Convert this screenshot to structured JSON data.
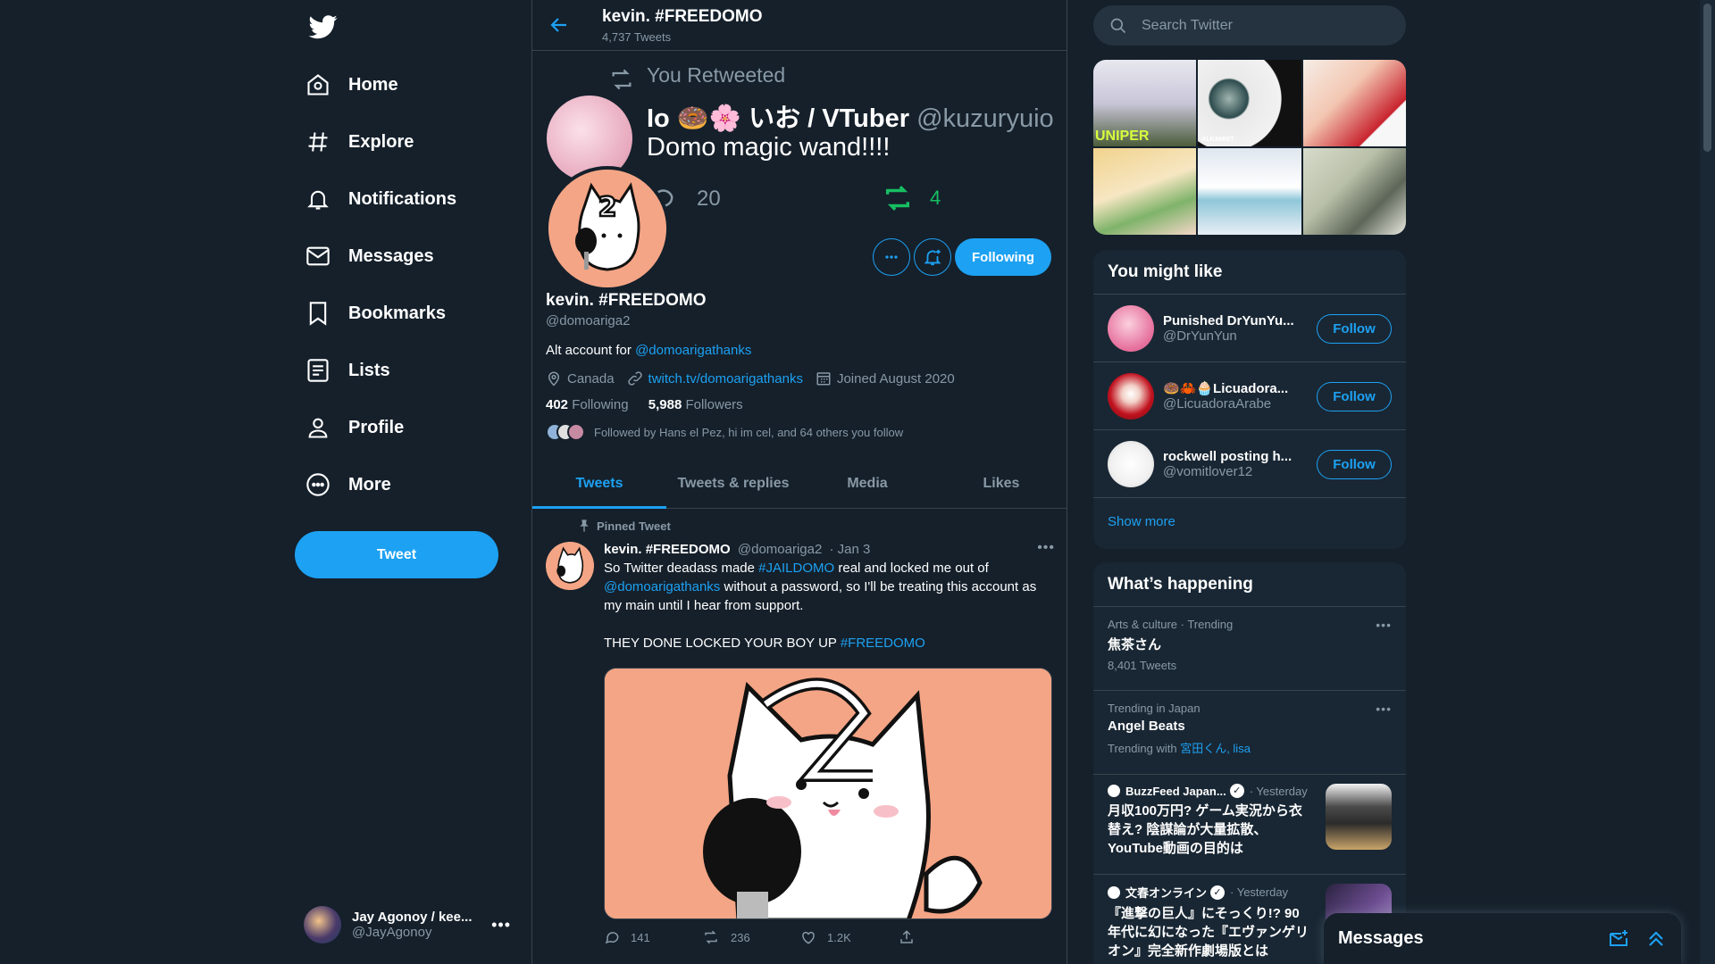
{
  "nav": {
    "items": [
      {
        "label": "Home",
        "icon": "home-icon"
      },
      {
        "label": "Explore",
        "icon": "hashtag-icon"
      },
      {
        "label": "Notifications",
        "icon": "bell-icon"
      },
      {
        "label": "Messages",
        "icon": "envelope-icon"
      },
      {
        "label": "Bookmarks",
        "icon": "bookmark-icon"
      },
      {
        "label": "Lists",
        "icon": "list-icon"
      },
      {
        "label": "Profile",
        "icon": "person-icon"
      },
      {
        "label": "More",
        "icon": "more-circle-icon"
      }
    ],
    "tweet_button": "Tweet",
    "account": {
      "name": "Jay Agonoy / kee...",
      "handle": "@JayAgonoy"
    }
  },
  "header": {
    "title": "kevin. #FREEDOMO",
    "tweet_count": "4,737 Tweets"
  },
  "banner": {
    "retweet_label": "You Retweeted",
    "name": "Io 🍩🌸 いお / VTuber",
    "handle": "@kuzuryuio",
    "text": "Domo magic wand!!!!",
    "reply_count": "20",
    "retweet_count": "4"
  },
  "profile": {
    "name": "kevin. #FREEDOMO",
    "handle": "@domoariga2",
    "bio_prefix": "Alt account for",
    "bio_link": "@domoarigathanks",
    "location": "Canada",
    "website": "twitch.tv/domoarigathanks",
    "joined": "Joined August 2020",
    "following_count": "402",
    "following_label": "Following",
    "followers_count": "5,988",
    "followers_label": "Followers",
    "followed_by": "Followed by Hans el Pez, hi im cel, and 64 others you follow",
    "following_button": "Following"
  },
  "tabs": [
    "Tweets",
    "Tweets & replies",
    "Media",
    "Likes"
  ],
  "active_tab": "Tweets",
  "pinned_tweet": {
    "pinned_label": "Pinned Tweet",
    "name": "kevin. #FREEDOMO",
    "handle": "@domoariga2",
    "date": "· Jan 3",
    "line1_a": "So Twitter deadass made",
    "line1_tag": "#JAILDOMO",
    "line1_b": "real and locked me out of",
    "line1_mention": "@domoarigathanks",
    "line1_c": "without a password, so I'll be treating this account as my main until I hear from support.",
    "line2_a": "THEY DONE LOCKED YOUR BOY UP",
    "line2_tag": "#FREEDOMO",
    "replies": "141",
    "retweets": "236",
    "likes": "1.2K"
  },
  "search": {
    "placeholder": "Search Twitter"
  },
  "media_grid": {
    "caption1": "UNIPER",
    "caption2": "ALKAMIST"
  },
  "you_might_like": {
    "title": "You might like",
    "users": [
      {
        "name": "Punished DrYunYu...",
        "handle": "@DrYunYun",
        "button": "Follow"
      },
      {
        "name": "🍩🦀🧁Licuadora...",
        "handle": "@LicuadoraArabe",
        "button": "Follow"
      },
      {
        "name": "rockwell posting h...",
        "handle": "@vomitlover12",
        "button": "Follow"
      }
    ],
    "show_more": "Show more"
  },
  "whats_happening": {
    "title": "What’s happening",
    "trends": [
      {
        "meta": "Arts & culture · Trending",
        "title": "焦茶さん",
        "count": "8,401 Tweets"
      },
      {
        "meta": "Trending in Japan",
        "title": "Angel Beats",
        "trending_with_label": "Trending with",
        "trending_with": "宮田くん, lisa"
      }
    ],
    "news": [
      {
        "source": "BuzzFeed Japan...",
        "time": "· Yesterday",
        "headline": "月収100万円? ゲーム実況から衣替え? 陰謀論が大量拡散、YouTube動画の目的は"
      },
      {
        "source": "文春オンライン",
        "time": "· Yesterday",
        "headline": "『進撃の巨人』にそっくり!? 90年代に幻になった『エヴァンゲリオン』完全新作劇場版とは"
      }
    ]
  },
  "messages_drawer": {
    "title": "Messages"
  },
  "colors": {
    "background": "#15202b",
    "accent": "#1da1f2",
    "muted": "#8899a6",
    "retweet": "#17bf63",
    "card": "#192734"
  }
}
